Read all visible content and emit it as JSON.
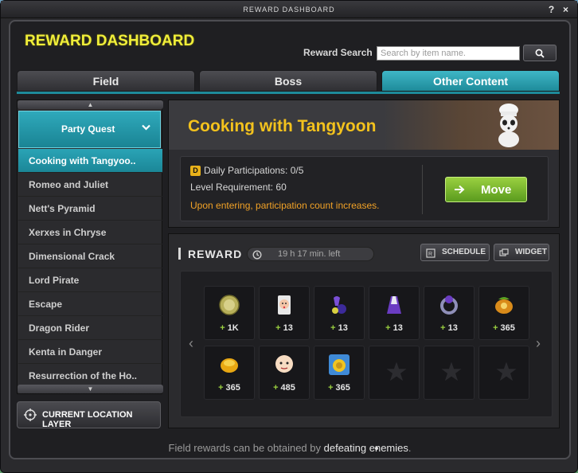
{
  "window": {
    "title": "REWARD DASHBOARD",
    "help_label": "?",
    "close_label": "×"
  },
  "header": {
    "title": "REWARD DASHBOARD",
    "search_label": "Reward Search",
    "search_placeholder": "Search by item name."
  },
  "tabs": [
    {
      "label": "Field",
      "active": false
    },
    {
      "label": "Boss",
      "active": false
    },
    {
      "label": "Other Content",
      "active": true
    }
  ],
  "sidebar": {
    "category": "Party Quest",
    "items": [
      {
        "label": "Cooking with Tangyoo..",
        "active": true
      },
      {
        "label": "Romeo and Juliet"
      },
      {
        "label": "Nett's Pyramid"
      },
      {
        "label": "Xerxes in Chryse"
      },
      {
        "label": "Dimensional Crack"
      },
      {
        "label": "Lord Pirate"
      },
      {
        "label": "Escape"
      },
      {
        "label": "Dragon Rider"
      },
      {
        "label": "Kenta in Danger"
      },
      {
        "label": "Resurrection of the Ho.."
      }
    ],
    "location_button": "CURRENT LOCATION LAYER"
  },
  "content": {
    "title": "Cooking with Tangyoon",
    "badge": "D",
    "daily": "Daily Participations: 0/5",
    "level": "Level Requirement: 60",
    "warning": "Upon entering, participation count increases.",
    "move_label": "Move"
  },
  "reward": {
    "title": "REWARD",
    "time_left": "19 h 17 min. left",
    "schedule_label": "SCHEDULE",
    "widget_label": "WIDGET",
    "items": [
      {
        "icon": "gold-coin-icon",
        "qty": "1K"
      },
      {
        "icon": "doll-tag-icon",
        "qty": "13"
      },
      {
        "icon": "purple-potion-icon",
        "qty": "13"
      },
      {
        "icon": "purple-robe-icon",
        "qty": "13"
      },
      {
        "icon": "purple-ring-icon",
        "qty": "13"
      },
      {
        "icon": "fruit-bowl-icon",
        "qty": "365"
      },
      {
        "icon": "golden-bun-icon",
        "qty": "365"
      },
      {
        "icon": "face-icon",
        "qty": "485"
      },
      {
        "icon": "coin-card-icon",
        "qty": "365"
      },
      {
        "icon": "empty-slot-icon",
        "qty": ""
      },
      {
        "icon": "empty-slot-icon",
        "qty": ""
      },
      {
        "icon": "empty-slot-icon",
        "qty": ""
      }
    ]
  },
  "footer": {
    "prefix": "Field rewards can be obtained by ",
    "highlight": "defeating enemies",
    "suffix": "."
  },
  "colors": {
    "accent": "#1e8b9a",
    "title_yellow": "#f0ee3a",
    "content_title": "#f3c21d",
    "warning": "#f2a226",
    "move_green": "#7bb832"
  }
}
